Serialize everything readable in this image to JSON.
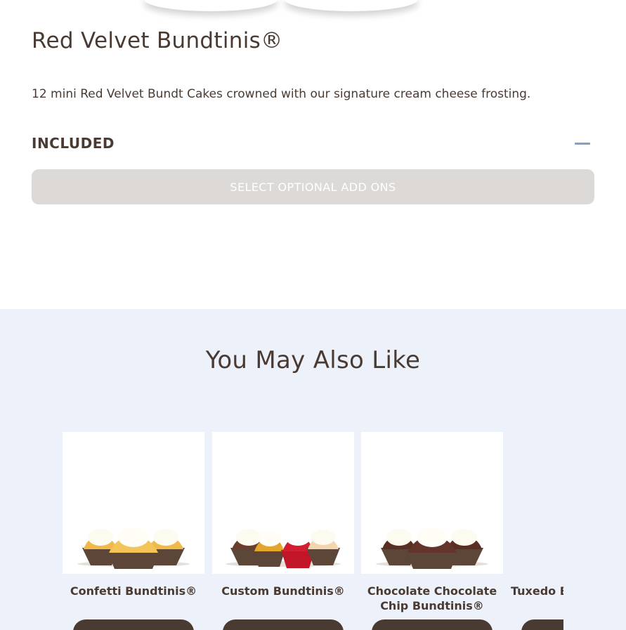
{
  "product": {
    "title": "Red Velvet Bundtinis®",
    "description": "12 mini Red Velvet Bundt Cakes crowned with our signature cream cheese frosting.",
    "included_label": "INCLUDED",
    "toggle_icon": "minus-icon",
    "addons_button_label": "SELECT OPTIONAL ADD ONS"
  },
  "recommendations": {
    "title": "You May Also Like",
    "items": [
      {
        "name": "Confetti Bundtinis®",
        "image": "confetti-bundtinis-image"
      },
      {
        "name": "Custom Bundtinis®",
        "image": "custom-bundtinis-image"
      },
      {
        "name": "Chocolate Chocolate Chip Bundtinis®",
        "image": "chocolate-chocolate-chip-bundtinis-image"
      },
      {
        "name": "Tuxedo Bundtinis®",
        "image": "tuxedo-bundtinis-image"
      }
    ]
  },
  "colors": {
    "text": "#4a3b32",
    "accent_blue": "#7aa3c8",
    "button_disabled": "#dcd9d7",
    "section_background": "#edf1f9",
    "card_button": "#4a3b32"
  }
}
